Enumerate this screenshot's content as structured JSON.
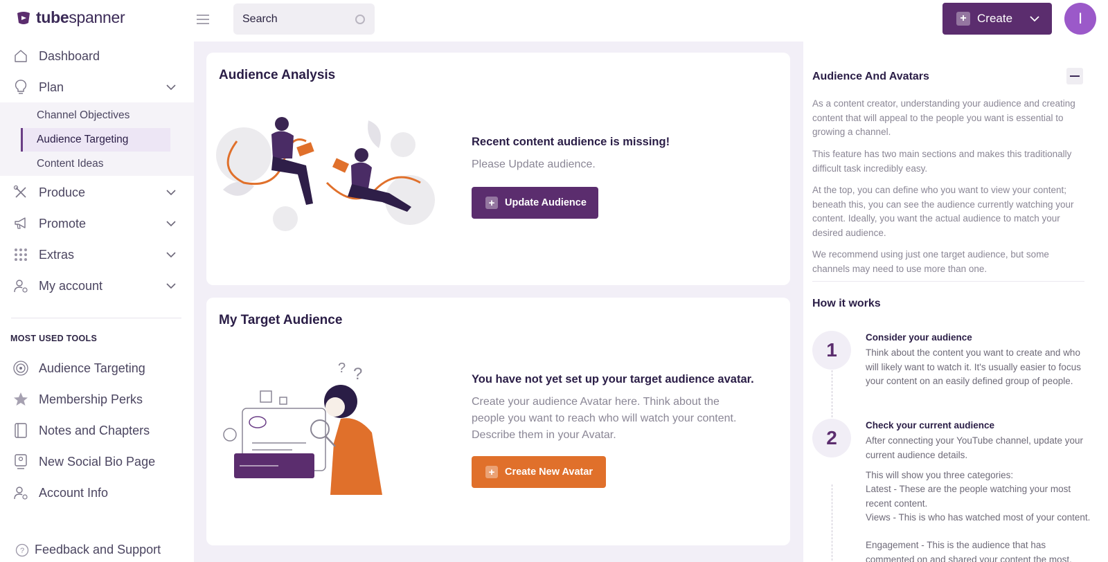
{
  "brand": {
    "name_bold": "tube",
    "name_light": "spanner"
  },
  "search": {
    "placeholder": "Search"
  },
  "header": {
    "create_label": "Create",
    "avatar_initial": "I"
  },
  "sidebar": {
    "items": [
      {
        "label": "Dashboard",
        "icon": "home-icon"
      },
      {
        "label": "Plan",
        "icon": "lightbulb-icon"
      },
      {
        "label": "Produce",
        "icon": "tools-icon"
      },
      {
        "label": "Promote",
        "icon": "megaphone-icon"
      },
      {
        "label": "Extras",
        "icon": "grid-dots-icon"
      },
      {
        "label": "My account",
        "icon": "user-gear-icon"
      }
    ],
    "plan_subitems": [
      "Channel Objectives",
      "Audience Targeting",
      "Content Ideas"
    ],
    "tools_title": "MOST USED TOOLS",
    "tools": [
      {
        "label": "Audience Targeting",
        "icon": "target-icon"
      },
      {
        "label": "Membership Perks",
        "icon": "star-icon"
      },
      {
        "label": "Notes and Chapters",
        "icon": "notebook-icon"
      },
      {
        "label": "New Social Bio Page",
        "icon": "profile-page-icon"
      },
      {
        "label": "Account Info",
        "icon": "user-gear-icon"
      }
    ],
    "feedback_label": "Feedback and Support"
  },
  "analysis": {
    "title": "Audience Analysis",
    "message_title": "Recent content audience is missing!",
    "message_body": "Please Update audience.",
    "button_label": "Update Audience"
  },
  "target": {
    "title": "My Target Audience",
    "message_title": "You have not yet set up your target audience avatar.",
    "message_body": "Create your audience Avatar here. Think about the people you want to reach who will watch your content. Describe them in your Avatar.",
    "button_label": "Create New Avatar"
  },
  "panel": {
    "title": "Audience And Avatars",
    "paragraphs": [
      "As a content creator, understanding your audience and creating content that will appeal to the people you want is essential to growing a channel.",
      "This feature has two main sections and makes this traditionally difficult task incredibly easy.",
      "At the top, you can define who you want to view your content; beneath this, you can see the audience currently watching your content. Ideally, you want the actual audience to match your desired audience.",
      "We recommend using just one target audience, but some channels may need to use more than one."
    ],
    "how_title": "How it works",
    "steps": [
      {
        "number": "1",
        "title": "Consider your audience",
        "body": "Think about the content you want to create and who will likely want to watch it. It's usually easier to focus your content on an easily defined group of people."
      },
      {
        "number": "2",
        "title": "Check your current audience",
        "body": "After connecting your YouTube channel, update your current audience details.",
        "extra": [
          "This will show you three categories:",
          "Latest - These are the people watching your most recent content.",
          "Views - This is who has watched most of your content.",
          "Engagement - This is the audience that has commented on and shared your content the most."
        ]
      }
    ]
  },
  "colors": {
    "brand_purple": "#5b2d6e",
    "accent_orange": "#e0702b",
    "avatar_purple": "#9b59c9"
  }
}
